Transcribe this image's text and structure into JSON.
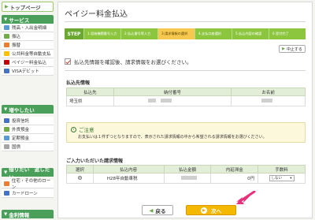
{
  "sidebar": {
    "top_label": "トップページ",
    "sections": [
      {
        "title": "サービス",
        "items": [
          {
            "label": "残高・入出金明細",
            "icon": "passbook-icon",
            "color": "#5b9bd5"
          },
          {
            "label": "振込",
            "icon": "transfer-icon",
            "color": "#70ad47"
          },
          {
            "label": "振替",
            "icon": "exchange-icon",
            "color": "#ed7d31"
          },
          {
            "label": "公共料金等自動支払",
            "icon": "utility-icon",
            "color": "#ffc000"
          },
          {
            "label": "ペイジー料金払込",
            "icon": "payeasy-icon",
            "color": "#c00000"
          },
          {
            "label": "VISAデビット",
            "icon": "card-icon",
            "color": "#4472c4"
          }
        ]
      },
      {
        "title": "増やしたい",
        "items": [
          {
            "label": "投資信託",
            "icon": "fund-icon",
            "color": "#4472c4"
          },
          {
            "label": "外貨預金",
            "icon": "forex-icon",
            "color": "#70ad47"
          },
          {
            "label": "定期預金",
            "icon": "deposit-icon",
            "color": "#5b9bd5"
          },
          {
            "label": "国債",
            "icon": "bond-icon",
            "color": "#a5a5a5"
          }
        ]
      },
      {
        "title": "借りたい　返したい",
        "items": [
          {
            "label": "住宅・その他のローン",
            "icon": "house-icon",
            "color": "#ed7d31"
          },
          {
            "label": "カードローン",
            "icon": "cardloan-icon",
            "color": "#4472c4"
          }
        ]
      },
      {
        "title": "金利情報",
        "items": []
      }
    ]
  },
  "main": {
    "title": "ペイジー料金払込",
    "step_label": "STEP",
    "steps": [
      {
        "label": "1.収納機関番号入力"
      },
      {
        "label": "2.払込番号等入力"
      },
      {
        "label": "3.請求情報の選択",
        "active": true
      },
      {
        "label": "4.支払口座選択"
      },
      {
        "label": "5.払込内容の確認"
      },
      {
        "label": "6.受付完了"
      }
    ],
    "cancel_label": "中止する",
    "confirm_text": "払込先情報を確認後、請求情報をお選びください。",
    "payee": {
      "title": "払込先情報",
      "headers": [
        "払込先",
        "納付番号",
        "お名前"
      ],
      "row": [
        "埼玉県",
        "",
        ""
      ]
    },
    "notice": {
      "title": "ご注意",
      "body": "お支払いは１件ずつとなりますので、表示された請求情報の中から希望される請求情報をお選びください。"
    },
    "billing": {
      "title": "ご入力いただいた請求情報",
      "headers": [
        "選択",
        "払込内容",
        "払込金額",
        "内延滞金",
        "手数料"
      ],
      "row": {
        "content": "H28年自動車税",
        "penalty": "0円",
        "fee_option": "しない"
      }
    },
    "back_label": "戻る",
    "next_label": "次へ"
  },
  "colors": {
    "accent_green": "#4aa05a",
    "step_bar": "#8cc63f",
    "active_step": "#f7c84f",
    "next_button": "#f5b800",
    "pointer": "#e8317b"
  }
}
